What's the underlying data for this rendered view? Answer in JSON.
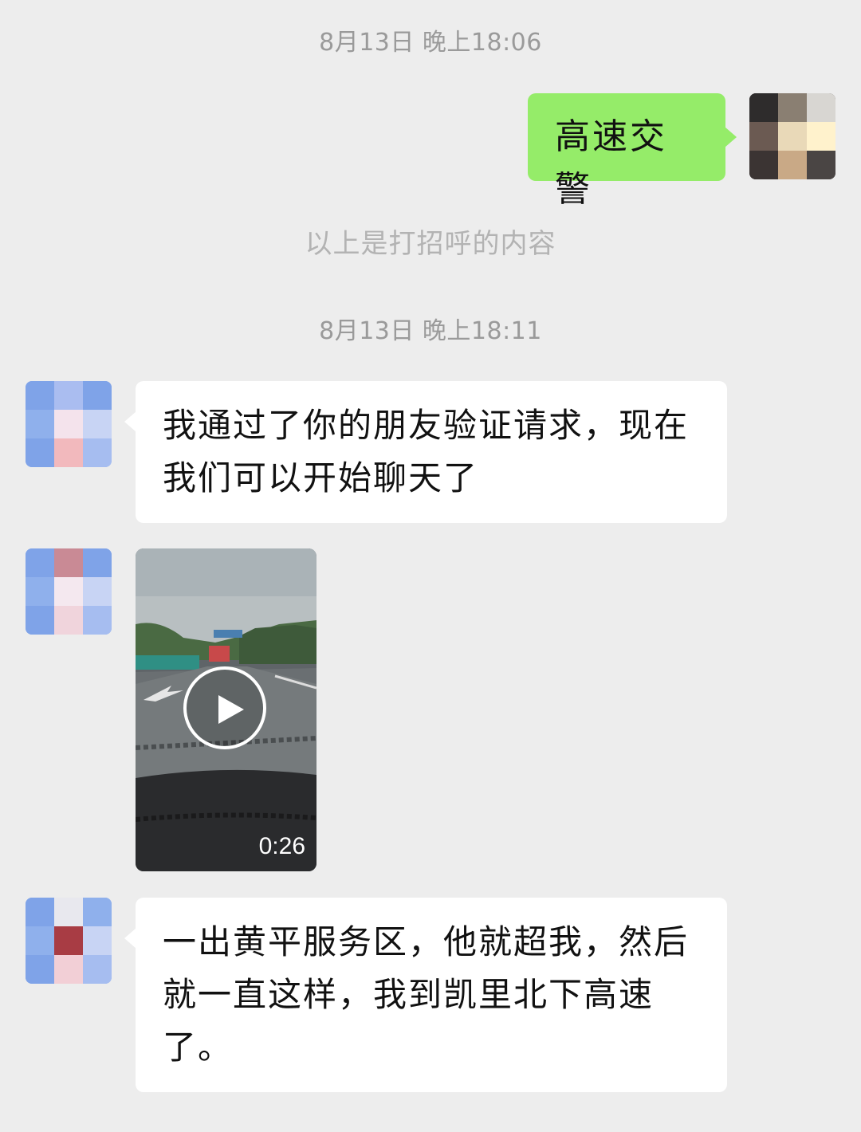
{
  "timestamps": [
    "8月13日 晚上18:06",
    "8月13日 晚上18:11"
  ],
  "system_note": "以上是打招呼的内容",
  "messages": [
    {
      "sender": "self",
      "text": "高速交警"
    },
    {
      "sender": "other",
      "text": "我通过了你的朋友验证请求，现在\n我们可以开始聊天了"
    },
    {
      "sender": "other",
      "type": "video",
      "duration": "0:26"
    },
    {
      "sender": "other",
      "text": "一出黄平服务区，他就超我，然后\n就一直这样，我到凯里北下高速\n了。"
    }
  ],
  "colors": {
    "background": "#ededed",
    "self_bubble": "#95ec69",
    "other_bubble": "#ffffff",
    "timestamp_text": "#9a9a9a"
  },
  "icons": [
    "play-icon"
  ]
}
